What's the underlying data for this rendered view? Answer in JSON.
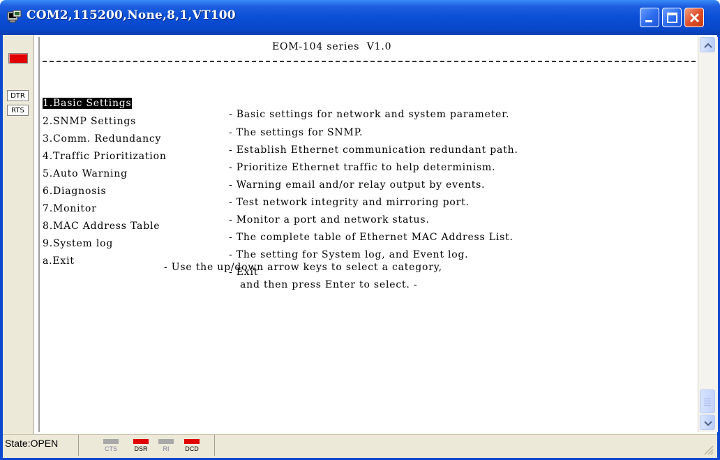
{
  "window": {
    "title": "COM2,115200,None,8,1,VT100",
    "controls": [
      "minimize",
      "maximize",
      "close"
    ],
    "frame_color": "#0a48d0"
  },
  "signal_panel": {
    "buttons": [
      "DTR",
      "RTS"
    ],
    "led_color": "#e00000"
  },
  "terminal": {
    "header": "EOM-104 series  V1.0",
    "menu": [
      {
        "name": "1.Basic Settings",
        "desc": "- Basic settings for network and system parameter.",
        "selected": true
      },
      {
        "name": "2.SNMP Settings",
        "desc": "- The settings for SNMP.",
        "selected": false
      },
      {
        "name": "3.Comm. Redundancy",
        "desc": "- Establish Ethernet communication redundant path.",
        "selected": false
      },
      {
        "name": "4.Traffic Prioritization",
        "desc": "- Prioritize Ethernet traffic to help determinism.",
        "selected": false
      },
      {
        "name": "5.Auto Warning",
        "desc": "- Warning email and/or relay output by events.",
        "selected": false
      },
      {
        "name": "6.Diagnosis",
        "desc": "- Test network integrity and mirroring port.",
        "selected": false
      },
      {
        "name": "7.Monitor",
        "desc": "- Monitor a port and network status.",
        "selected": false
      },
      {
        "name": "8.MAC Address Table",
        "desc": "- The complete table of Ethernet MAC Address List.",
        "selected": false
      },
      {
        "name": "9.System log",
        "desc": "- The setting for System log, and Event log.",
        "selected": false
      },
      {
        "name": "a.Exit",
        "desc": "- Exit",
        "selected": false
      }
    ],
    "hint_line1": "- Use the up/down arrow keys to select a category,",
    "hint_line2": "and then press Enter to select. -"
  },
  "statusbar": {
    "state": "State:OPEN",
    "indicators": [
      {
        "label": "CTS",
        "on": false
      },
      {
        "label": "DSR",
        "on": true
      },
      {
        "label": "RI",
        "on": false
      },
      {
        "label": "DCD",
        "on": true
      }
    ]
  }
}
